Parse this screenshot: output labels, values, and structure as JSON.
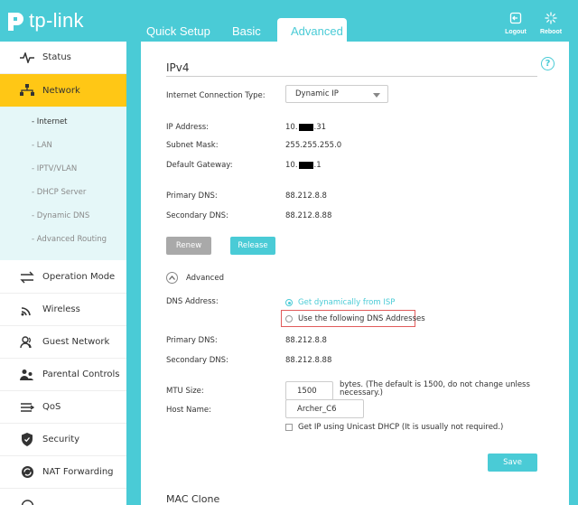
{
  "brand": {
    "logo_text": "tp-link"
  },
  "tabs": [
    {
      "label": "Quick Setup"
    },
    {
      "label": "Basic"
    },
    {
      "label": "Advanced",
      "active": true
    }
  ],
  "header_buttons": {
    "logout": "Logout",
    "reboot": "Reboot"
  },
  "sidebar": {
    "items": [
      {
        "label": "Status",
        "icon": "pulse-icon"
      },
      {
        "label": "Network",
        "icon": "network-icon",
        "active": true
      },
      {
        "label": "Operation Mode",
        "icon": "swap-icon"
      },
      {
        "label": "Wireless",
        "icon": "wifi-icon"
      },
      {
        "label": "Guest Network",
        "icon": "guest-icon"
      },
      {
        "label": "Parental Controls",
        "icon": "parental-icon"
      },
      {
        "label": "QoS",
        "icon": "qos-icon"
      },
      {
        "label": "Security",
        "icon": "shield-icon"
      },
      {
        "label": "NAT Forwarding",
        "icon": "nat-icon"
      }
    ],
    "sub_items": [
      {
        "label": "- Internet",
        "active": true
      },
      {
        "label": "- LAN"
      },
      {
        "label": "- IPTV/VLAN"
      },
      {
        "label": "- DHCP Server"
      },
      {
        "label": "- Dynamic DNS"
      },
      {
        "label": "- Advanced Routing"
      }
    ]
  },
  "main": {
    "section_title": "IPv4",
    "connection_type_label": "Internet Connection Type:",
    "connection_type_value": "Dynamic IP",
    "ip_label": "IP Address:",
    "ip_prefix": "10.",
    "ip_suffix": ".31",
    "subnet_label": "Subnet Mask:",
    "subnet_value": "255.255.255.0",
    "gateway_label": "Default Gateway:",
    "gateway_prefix": "10.",
    "gateway_suffix": ".1",
    "primary_dns_label": "Primary DNS:",
    "primary_dns_value": "88.212.8.8",
    "secondary_dns_label": "Secondary DNS:",
    "secondary_dns_value": "88.212.8.88",
    "renew_label": "Renew",
    "release_label": "Release",
    "advanced_label": "Advanced",
    "dns_address_label": "DNS Address:",
    "dns_option_dynamic": "Get dynamically from ISP",
    "dns_option_manual": "Use the following DNS Addresses",
    "adv_primary_dns_label": "Primary DNS:",
    "adv_primary_dns_value": "88.212.8.8",
    "adv_secondary_dns_label": "Secondary DNS:",
    "adv_secondary_dns_value": "88.212.8.88",
    "mtu_label": "MTU Size:",
    "mtu_value": "1500",
    "mtu_note": "bytes. (The default is 1500, do not change unless necessary.)",
    "host_label": "Host Name:",
    "host_value": "Archer_C6",
    "unicast_label": "Get IP using Unicast DHCP (It is usually not required.)",
    "save_label": "Save",
    "next_section_title": "MAC Clone"
  },
  "colors": {
    "accent": "#4acbd6",
    "active_nav": "#ffc715",
    "highlight": "#e15b5b"
  }
}
